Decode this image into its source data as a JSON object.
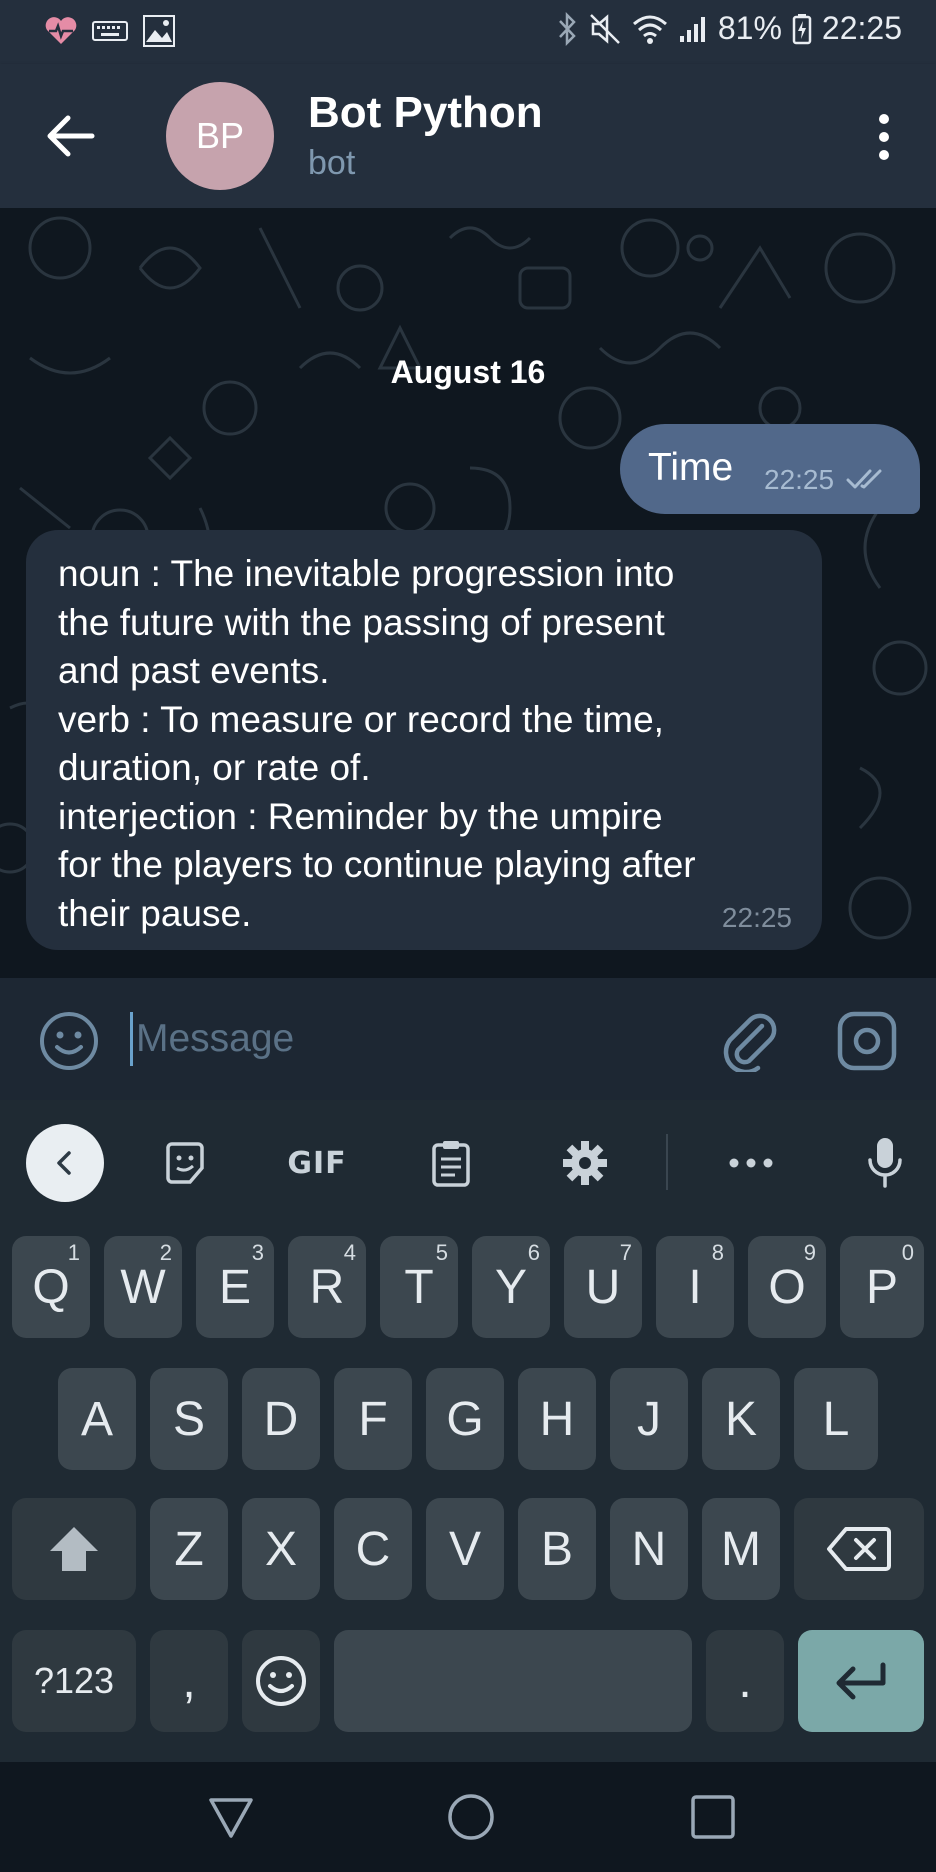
{
  "status_bar": {
    "icons_left": [
      "heart-monitor-icon",
      "keyboard-icon",
      "image-icon"
    ],
    "icons_right": [
      "bluetooth-icon",
      "mute-icon",
      "wifi-icon",
      "signal-icon"
    ],
    "battery": "81%",
    "time": "22:25"
  },
  "header": {
    "avatar_initials": "BP",
    "avatar_color": "#c6a3ad",
    "title": "Bot Python",
    "subtitle": "bot"
  },
  "chat": {
    "date": "August 16",
    "messages": [
      {
        "direction": "outgoing",
        "text": "Time",
        "time": "22:25",
        "status": "read"
      },
      {
        "direction": "incoming",
        "text": "noun : The inevitable progression into\nthe future with the passing of present\nand past events.\nverb : To measure or record the time,\nduration, or rate of.\ninterjection : Reminder by the umpire\nfor the players to continue playing after\ntheir pause.",
        "time": "22:25"
      }
    ]
  },
  "input": {
    "placeholder": "Message",
    "value": ""
  },
  "keyboard": {
    "toolbar": {
      "gif_label": "GIF",
      "icons": [
        "collapse-icon",
        "sticker-icon",
        "gif-icon",
        "clipboard-icon",
        "settings-icon",
        "more-icon",
        "mic-icon"
      ]
    },
    "row1": [
      {
        "label": "Q",
        "hint": "1"
      },
      {
        "label": "W",
        "hint": "2"
      },
      {
        "label": "E",
        "hint": "3"
      },
      {
        "label": "R",
        "hint": "4"
      },
      {
        "label": "T",
        "hint": "5"
      },
      {
        "label": "Y",
        "hint": "6"
      },
      {
        "label": "U",
        "hint": "7"
      },
      {
        "label": "I",
        "hint": "8"
      },
      {
        "label": "O",
        "hint": "9"
      },
      {
        "label": "P",
        "hint": "0"
      }
    ],
    "row2": [
      "A",
      "S",
      "D",
      "F",
      "G",
      "H",
      "J",
      "K",
      "L"
    ],
    "row3": [
      "Z",
      "X",
      "C",
      "V",
      "B",
      "N",
      "M"
    ],
    "symbols_label": "?123",
    "comma_label": ",",
    "period_label": "."
  },
  "colors": {
    "header_bg": "#242f3d",
    "chat_bg": "#0f171f",
    "outgoing_bubble": "#51688a",
    "incoming_bubble": "#242f3d",
    "enter_key": "#7ba8a8"
  }
}
